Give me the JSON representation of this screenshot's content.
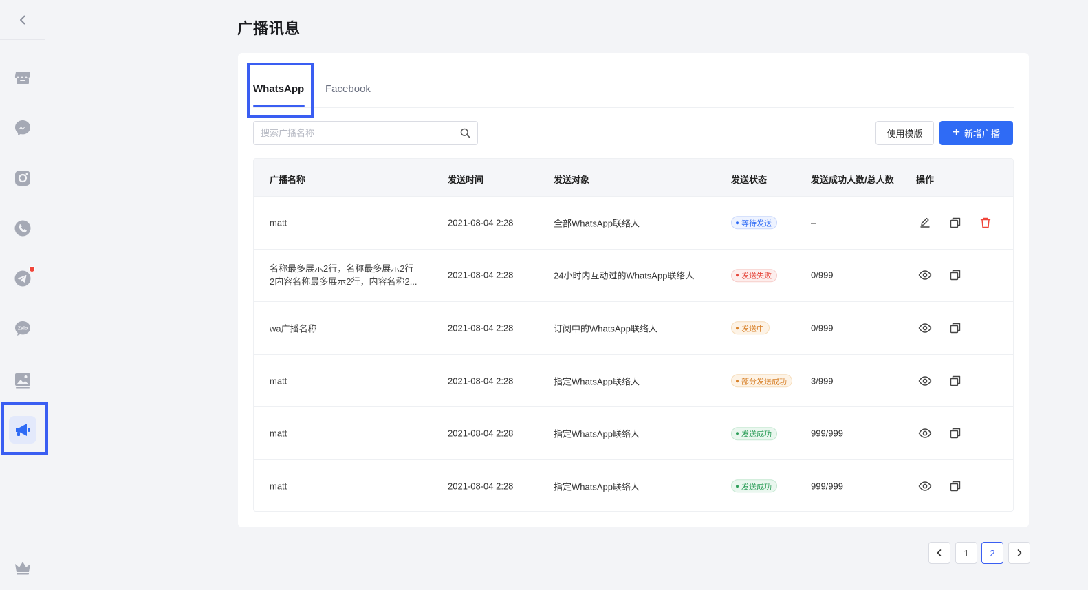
{
  "page": {
    "title": "广播讯息"
  },
  "sidebar": {
    "items": [
      {
        "icon": "back-chevron-icon"
      },
      {
        "icon": "store-icon"
      },
      {
        "icon": "messenger-icon"
      },
      {
        "icon": "instagram-icon"
      },
      {
        "icon": "whatsapp-icon"
      },
      {
        "icon": "telegram-icon",
        "has_notification": true
      },
      {
        "icon": "zalo-icon",
        "label": "Zalo"
      },
      {
        "icon": "image-gallery-icon"
      },
      {
        "icon": "megaphone-icon",
        "active": true
      },
      {
        "icon": "crown-icon"
      }
    ]
  },
  "tabs": [
    {
      "label": "WhatsApp",
      "active": true
    },
    {
      "label": "Facebook",
      "active": false
    }
  ],
  "search": {
    "placeholder": "搜索广播名称",
    "value": ""
  },
  "toolbar": {
    "template_label": "使用模版",
    "add_label": "新增广播"
  },
  "table": {
    "headers": [
      "广播名称",
      "发送时间",
      "发送对象",
      "发送状态",
      "发送成功人数/总人数",
      "操作"
    ],
    "rows": [
      {
        "name": "matt",
        "time": "2021-08-04 2:28",
        "target": "全部WhatsApp联络人",
        "status": "等待发送",
        "count": "–",
        "actions": [
          "edit",
          "copy",
          "delete"
        ]
      },
      {
        "name": "名称最多展示2行，名称最多展示2行2内容名称最多展示2行，内容名称2...",
        "time": "2021-08-04 2:28",
        "target": "24小时内互动过的WhatsApp联络人",
        "status": "发送失败",
        "count": "0/999",
        "actions": [
          "view",
          "copy"
        ]
      },
      {
        "name": "wa广播名称",
        "time": "2021-08-04 2:28",
        "target": "订阅中的WhatsApp联络人",
        "status": "发送中",
        "count": "0/999",
        "actions": [
          "view",
          "copy"
        ]
      },
      {
        "name": "matt",
        "time": "2021-08-04 2:28",
        "target": "指定WhatsApp联络人",
        "status": "部分发送成功",
        "count": "3/999",
        "actions": [
          "view",
          "copy"
        ]
      },
      {
        "name": "matt",
        "time": "2021-08-04 2:28",
        "target": "指定WhatsApp联络人",
        "status": "发送成功",
        "count": "999/999",
        "actions": [
          "view",
          "copy"
        ]
      },
      {
        "name": "matt",
        "time": "2021-08-04 2:28",
        "target": "指定WhatsApp联络人",
        "status": "发送成功",
        "count": "999/999",
        "actions": [
          "view",
          "copy"
        ]
      }
    ]
  },
  "status_colors": {
    "等待发送": {
      "text": "#2f6bf5",
      "bg": "#eef3ff",
      "border": "#c9d7fb"
    },
    "发送失败": {
      "text": "#e5483d",
      "bg": "#fdeeed",
      "border": "#f7cdca"
    },
    "发送中": {
      "text": "#d8822b",
      "bg": "#fdf3e6",
      "border": "#f6dcb9"
    },
    "部分发送成功": {
      "text": "#d8822b",
      "bg": "#fdf3e6",
      "border": "#f6dcb9"
    },
    "发送成功": {
      "text": "#2f9f5b",
      "bg": "#eaf7ef",
      "border": "#c5e8d2"
    }
  },
  "pagination": {
    "pages": [
      "1",
      "2"
    ],
    "current": "2"
  },
  "colors": {
    "accent": "#3a5ef2",
    "primary_button": "#2f6bf5",
    "delete": "#f0453a"
  }
}
